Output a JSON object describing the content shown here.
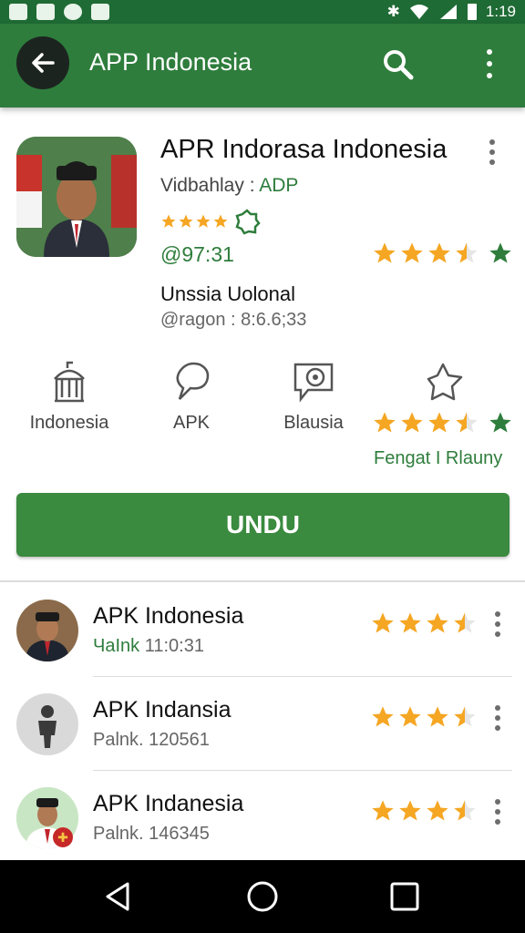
{
  "status_bar": {
    "time": "1:19"
  },
  "app_bar": {
    "title": "APP Indonesia"
  },
  "app": {
    "name": "APR Indorasa Indonesia",
    "developer_prefix": "Vidbahlay : ",
    "developer_name": "ADP",
    "price": "@97:31",
    "subtitle": "Unssia Uolonal",
    "version_line": "@ragon : 8:6.6;33",
    "top_rating": 3.5
  },
  "features": [
    {
      "icon": "museum-icon",
      "label": "Indonesia"
    },
    {
      "icon": "speech-bubble-icon",
      "label": "APK"
    },
    {
      "icon": "chat-swirl-icon",
      "label": "Blausia"
    }
  ],
  "mid_rating": {
    "value": 3.5,
    "caption": "Fengat I Rlauny"
  },
  "install_button": {
    "label": "UNDU"
  },
  "list": [
    {
      "title": "APK Indonesia",
      "tag": "ЧaInk",
      "meta": " 11:0:31",
      "rating": 3.5,
      "avatar": "person-photo"
    },
    {
      "title": "APK Indansia",
      "tag": "",
      "meta": "Palnk. 120561",
      "rating": 3.5,
      "avatar": "person-icon"
    },
    {
      "title": "APK Indanesia",
      "tag": "",
      "meta": "Palnk. 146345",
      "rating": 3.5,
      "avatar": "person-photo-badge"
    }
  ],
  "colors": {
    "primary": "#2e7d3c",
    "status_bar": "#1f6b35",
    "star": "#f5a623"
  }
}
